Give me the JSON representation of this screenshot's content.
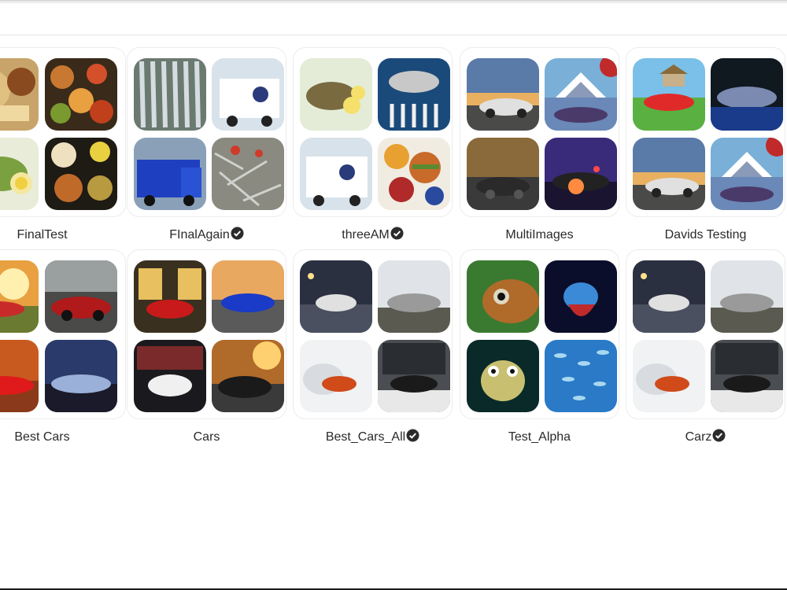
{
  "search": {
    "value": "",
    "placeholder": ""
  },
  "collections": [
    {
      "name": "FinalTest",
      "verified": false
    },
    {
      "name": "FInalAgain",
      "verified": true
    },
    {
      "name": "threeAM",
      "verified": true
    },
    {
      "name": "MultiImages",
      "verified": false
    },
    {
      "name": "Davids Testing",
      "verified": false
    },
    {
      "name": "Best Cars",
      "verified": false
    },
    {
      "name": "Cars",
      "verified": false
    },
    {
      "name": "Best_Cars_All",
      "verified": true
    },
    {
      "name": "Test_Alpha",
      "verified": false
    },
    {
      "name": "Carz",
      "verified": true
    }
  ],
  "icons": {
    "verified": "check-circle-icon"
  },
  "colors": {
    "verified_badge": "#2b2b2b",
    "card_border": "#ececec"
  }
}
